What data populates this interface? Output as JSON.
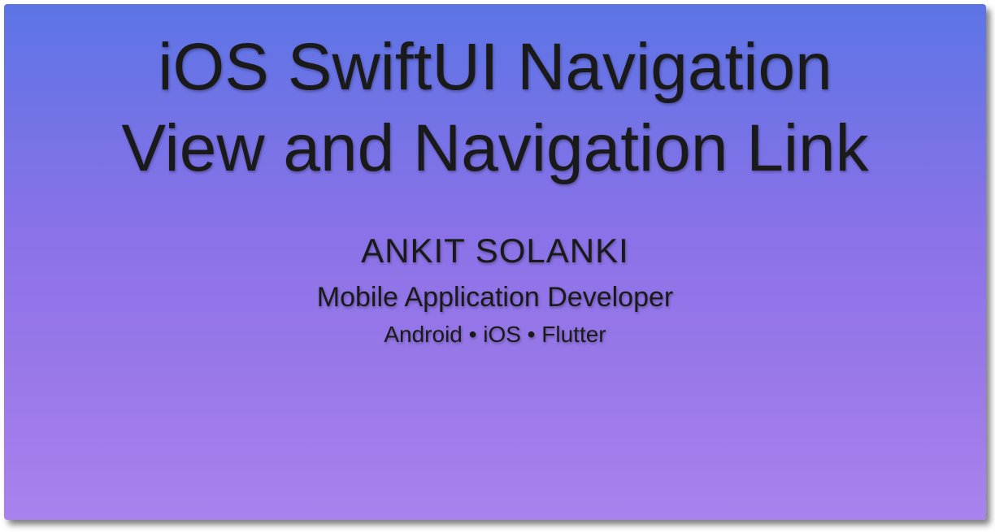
{
  "slide": {
    "title": "iOS SwiftUI Navigation View and Navigation Link",
    "author": "ANKIT SOLANKI",
    "role": "Mobile Application Developer",
    "platforms": "Android • iOS • Flutter"
  },
  "colors": {
    "gradient_top": "#5c74e5",
    "gradient_bottom": "#a883ee",
    "text": "#1a1a1a"
  }
}
